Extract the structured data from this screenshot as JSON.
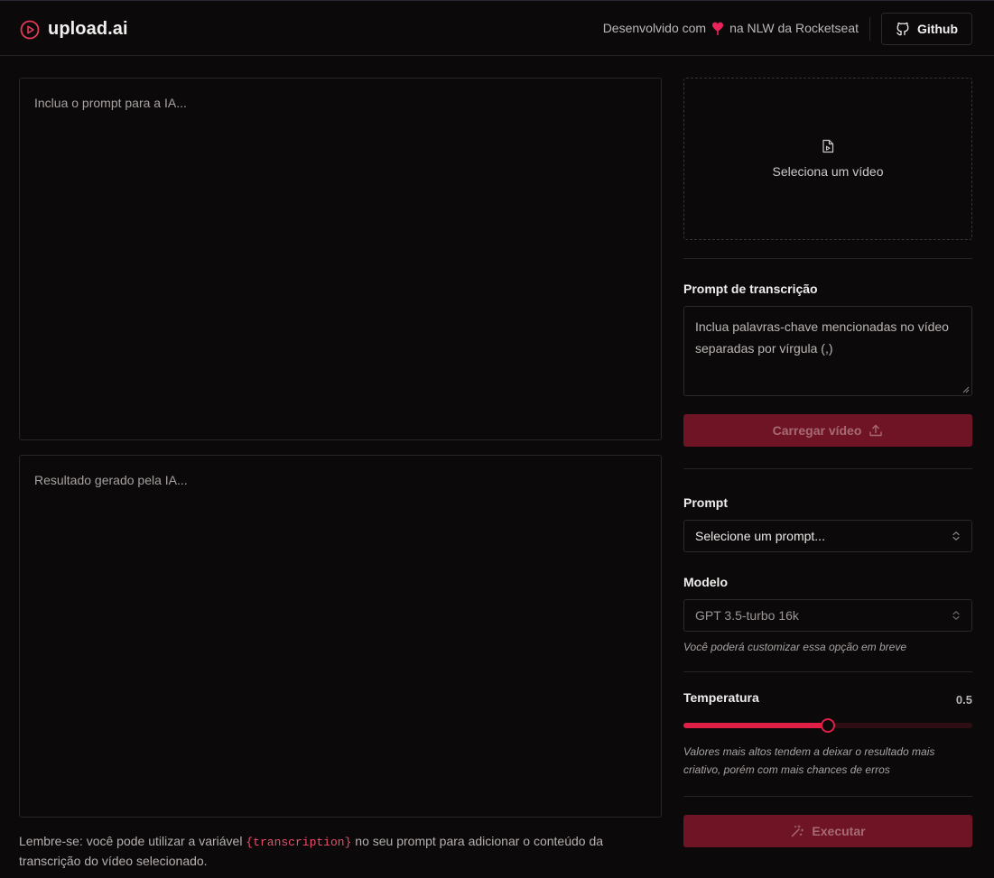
{
  "header": {
    "app_name": "upload.ai",
    "credit_prefix": "Desenvolvido com",
    "credit_suffix": "na NLW da Rocketseat",
    "github_label": "Github"
  },
  "editor": {
    "prompt_placeholder": "Inclua o prompt para a IA...",
    "result_placeholder": "Resultado gerado pela IA..."
  },
  "hint": {
    "before": "Lembre-se: você pode utilizar a variável",
    "variable": "{transcription}",
    "after": "no seu prompt para adicionar o conteúdo da transcrição do vídeo selecionado."
  },
  "sidebar": {
    "video_select_label": "Seleciona um vídeo",
    "transcription_label": "Prompt de transcrição",
    "transcription_placeholder": "Inclua palavras-chave mencionadas no vídeo separadas por vírgula (,)",
    "upload_button": "Carregar vídeo",
    "prompt_label": "Prompt",
    "prompt_select": "Selecione um prompt...",
    "model_label": "Modelo",
    "model_select": "GPT 3.5-turbo 16k",
    "model_note": "Você poderá customizar essa opção em breve",
    "temperature_label": "Temperatura",
    "temperature_value": "0.5",
    "temperature_fraction": 0.5,
    "temperature_note": "Valores mais altos tendem a deixar o resultado mais criativo, porém com mais chances de erros",
    "execute_button": "Executar"
  },
  "colors": {
    "accent": "#e01f47",
    "button_disabled_bg": "#6e1424",
    "background": "#0b0909"
  }
}
